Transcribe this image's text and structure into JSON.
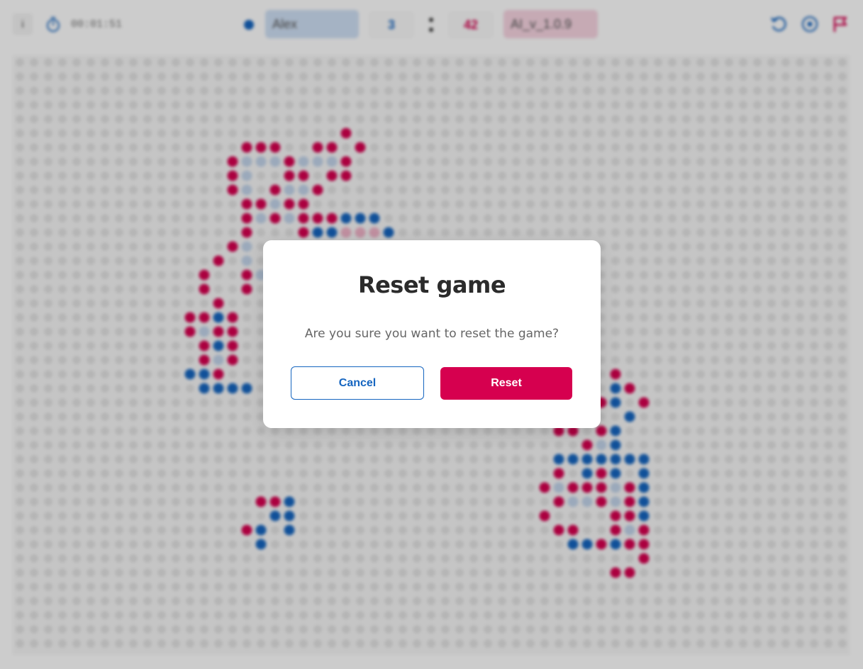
{
  "header": {
    "info_label": "i",
    "timer": "00:01:51",
    "player1": {
      "name": "Alex",
      "score": "3",
      "color": "#1565c0"
    },
    "player2": {
      "name": "AI_v_1.0.9",
      "score": "42",
      "color": "#d6004f"
    },
    "icons": [
      "info-icon",
      "timer-icon",
      "undo-icon",
      "settings-icon",
      "flag-icon"
    ]
  },
  "board": {
    "cols": 59,
    "rows": 42,
    "empty_color": "#e3e3e3",
    "red": "#d6004f",
    "blue": "#1565c0",
    "light_blue": "#c2d4ea",
    "light_red": "#f0b3c8",
    "stones": {
      "R": [
        [
          23,
          5
        ],
        [
          16,
          6
        ],
        [
          17,
          6
        ],
        [
          18,
          6
        ],
        [
          21,
          6
        ],
        [
          22,
          6
        ],
        [
          24,
          6
        ],
        [
          15,
          7
        ],
        [
          19,
          7
        ],
        [
          23,
          7
        ],
        [
          15,
          8
        ],
        [
          19,
          8
        ],
        [
          20,
          8
        ],
        [
          22,
          8
        ],
        [
          23,
          8
        ],
        [
          15,
          9
        ],
        [
          18,
          9
        ],
        [
          21,
          9
        ],
        [
          16,
          10
        ],
        [
          17,
          10
        ],
        [
          19,
          10
        ],
        [
          20,
          10
        ],
        [
          16,
          11
        ],
        [
          18,
          11
        ],
        [
          20,
          11
        ],
        [
          21,
          11
        ],
        [
          22,
          11
        ],
        [
          16,
          12
        ],
        [
          20,
          12
        ],
        [
          15,
          13
        ],
        [
          14,
          14
        ],
        [
          13,
          15
        ],
        [
          16,
          15
        ],
        [
          13,
          16
        ],
        [
          16,
          16
        ],
        [
          14,
          17
        ],
        [
          12,
          18
        ],
        [
          13,
          18
        ],
        [
          15,
          18
        ],
        [
          12,
          19
        ],
        [
          14,
          19
        ],
        [
          15,
          19
        ],
        [
          13,
          20
        ],
        [
          15,
          20
        ],
        [
          13,
          21
        ],
        [
          15,
          21
        ],
        [
          14,
          22
        ],
        [
          42,
          22
        ],
        [
          43,
          23
        ],
        [
          41,
          24
        ],
        [
          44,
          24
        ],
        [
          38,
          26
        ],
        [
          39,
          26
        ],
        [
          41,
          26
        ],
        [
          40,
          27
        ],
        [
          38,
          29
        ],
        [
          41,
          29
        ],
        [
          37,
          30
        ],
        [
          39,
          30
        ],
        [
          40,
          30
        ],
        [
          41,
          30
        ],
        [
          43,
          30
        ],
        [
          38,
          31
        ],
        [
          41,
          31
        ],
        [
          43,
          31
        ],
        [
          37,
          32
        ],
        [
          42,
          32
        ],
        [
          43,
          32
        ],
        [
          38,
          33
        ],
        [
          39,
          33
        ],
        [
          42,
          33
        ],
        [
          44,
          33
        ],
        [
          41,
          34
        ],
        [
          43,
          34
        ],
        [
          44,
          34
        ],
        [
          44,
          35
        ],
        [
          42,
          36
        ],
        [
          43,
          36
        ],
        [
          17,
          31
        ],
        [
          18,
          31
        ],
        [
          16,
          33
        ]
      ],
      "B": [
        [
          23,
          11
        ],
        [
          24,
          11
        ],
        [
          25,
          11
        ],
        [
          21,
          12
        ],
        [
          22,
          12
        ],
        [
          26,
          12
        ],
        [
          14,
          18
        ],
        [
          15,
          18
        ],
        [
          14,
          19
        ],
        [
          15,
          19
        ],
        [
          14,
          20
        ],
        [
          15,
          20
        ],
        [
          13,
          22
        ],
        [
          12,
          22
        ],
        [
          13,
          23
        ],
        [
          14,
          23
        ],
        [
          15,
          23
        ],
        [
          16,
          23
        ],
        [
          42,
          23
        ],
        [
          42,
          24
        ],
        [
          43,
          25
        ],
        [
          42,
          26
        ],
        [
          42,
          27
        ],
        [
          39,
          28
        ],
        [
          42,
          28
        ],
        [
          38,
          29
        ],
        [
          40,
          29
        ],
        [
          42,
          29
        ],
        [
          38,
          28
        ],
        [
          39,
          28
        ],
        [
          40,
          28
        ],
        [
          41,
          28
        ],
        [
          43,
          28
        ],
        [
          44,
          28
        ],
        [
          44,
          29
        ],
        [
          44,
          30
        ],
        [
          44,
          31
        ],
        [
          44,
          32
        ],
        [
          44,
          33
        ],
        [
          44,
          34
        ],
        [
          39,
          34
        ],
        [
          40,
          34
        ],
        [
          41,
          34
        ],
        [
          42,
          34
        ],
        [
          19,
          31
        ],
        [
          18,
          32
        ],
        [
          19,
          32
        ],
        [
          17,
          33
        ],
        [
          19,
          33
        ],
        [
          17,
          34
        ]
      ],
      "LB": [
        [
          16,
          7
        ],
        [
          17,
          7
        ],
        [
          18,
          7
        ],
        [
          21,
          7
        ],
        [
          22,
          7
        ],
        [
          16,
          8
        ],
        [
          20,
          7
        ],
        [
          16,
          9
        ],
        [
          19,
          9
        ],
        [
          20,
          9
        ],
        [
          18,
          10
        ],
        [
          17,
          11
        ],
        [
          19,
          11
        ],
        [
          16,
          13
        ],
        [
          16,
          14
        ],
        [
          17,
          15
        ],
        [
          14,
          19
        ],
        [
          13,
          19
        ],
        [
          14,
          20
        ],
        [
          14,
          21
        ],
        [
          41,
          27
        ],
        [
          38,
          30
        ],
        [
          42,
          30
        ],
        [
          38,
          31
        ],
        [
          39,
          31
        ],
        [
          40,
          31
        ],
        [
          42,
          31
        ],
        [
          43,
          33
        ]
      ],
      "LR": [
        [
          23,
          12
        ],
        [
          24,
          12
        ],
        [
          25,
          12
        ]
      ]
    }
  },
  "dialog": {
    "title": "Reset game",
    "message": "Are you sure you want to reset the game?",
    "cancel_label": "Cancel",
    "reset_label": "Reset"
  }
}
